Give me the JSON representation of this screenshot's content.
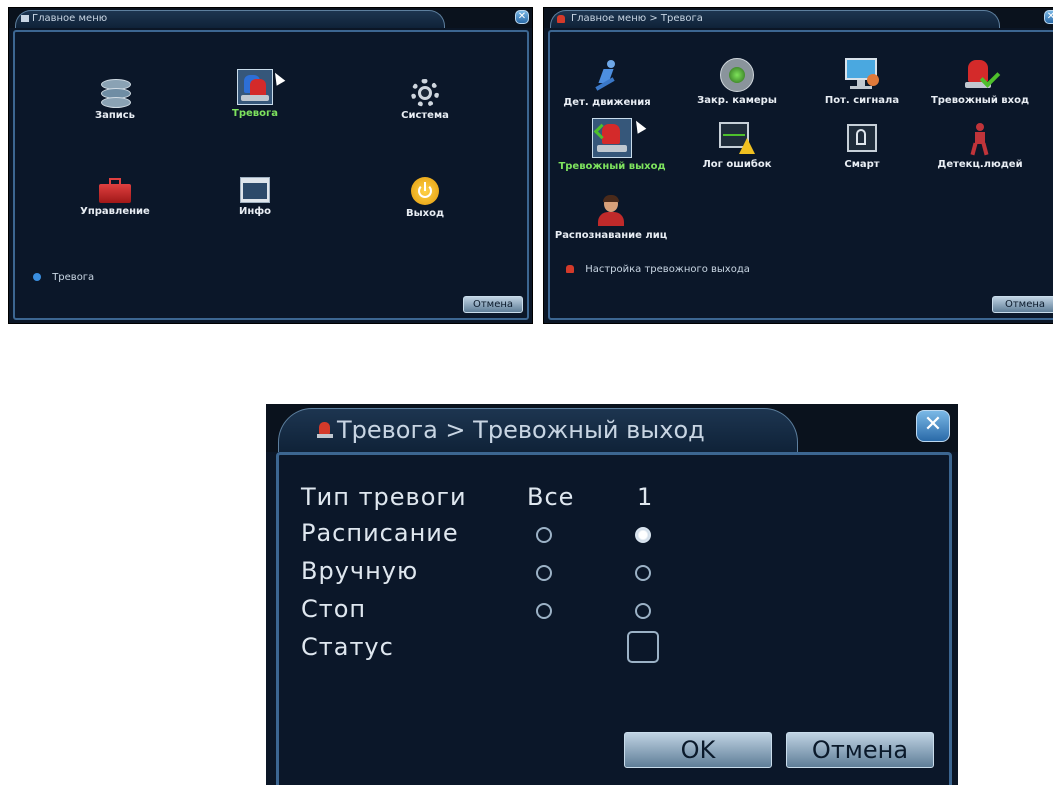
{
  "main_menu": {
    "title": "Главное меню",
    "items": [
      {
        "label": "Запись",
        "icon": "record-reel-icon",
        "active": false
      },
      {
        "label": "Тревога",
        "icon": "alarm-siren-icon",
        "active": true
      },
      {
        "label": "Система",
        "icon": "gear-icon",
        "active": false
      },
      {
        "label": "Управление",
        "icon": "toolbox-icon",
        "active": false
      },
      {
        "label": "Инфо",
        "icon": "info-window-icon",
        "active": false
      },
      {
        "label": "Выход",
        "icon": "power-icon",
        "active": false
      }
    ],
    "hint": "Тревога",
    "cancel_label": "Отмена"
  },
  "alarm_menu": {
    "title": "Главное меню > Тревога",
    "items": [
      {
        "label": "Дет. движения",
        "icon": "motion-runner-icon",
        "active": false
      },
      {
        "label": "Закр. камеры",
        "icon": "camera-lens-icon",
        "active": false
      },
      {
        "label": "Пот. сигнала",
        "icon": "monitor-signal-icon",
        "active": false
      },
      {
        "label": "Тревожный вход",
        "icon": "alarm-input-icon",
        "active": false
      },
      {
        "label": "Тревожный выход",
        "icon": "alarm-output-icon",
        "active": true
      },
      {
        "label": "Лог ошибок",
        "icon": "error-log-icon",
        "active": false
      },
      {
        "label": "Смарт",
        "icon": "smart-exit-icon",
        "active": false
      },
      {
        "label": "Детекц.людей",
        "icon": "human-detect-icon",
        "active": false
      },
      {
        "label": "Распознавание лиц",
        "icon": "face-recognition-icon",
        "active": false
      }
    ],
    "hint": "Настройка тревожного выхода",
    "cancel_label": "Отмена"
  },
  "alarm_output": {
    "title": "Тревога > Тревожный выход",
    "header": {
      "label": "Тип тревоги",
      "col_all": "Все",
      "col_1": "1"
    },
    "rows": [
      {
        "label": "Расписание",
        "all": false,
        "ch1": true
      },
      {
        "label": "Вручную",
        "all": false,
        "ch1": false
      },
      {
        "label": "Стоп",
        "all": false,
        "ch1": false
      }
    ],
    "status_label": "Статус",
    "ok_label": "OK",
    "cancel_label": "Отмена"
  },
  "colors": {
    "background": "#0b1729",
    "border": "#3c6691",
    "active_text": "#7ee35e"
  }
}
